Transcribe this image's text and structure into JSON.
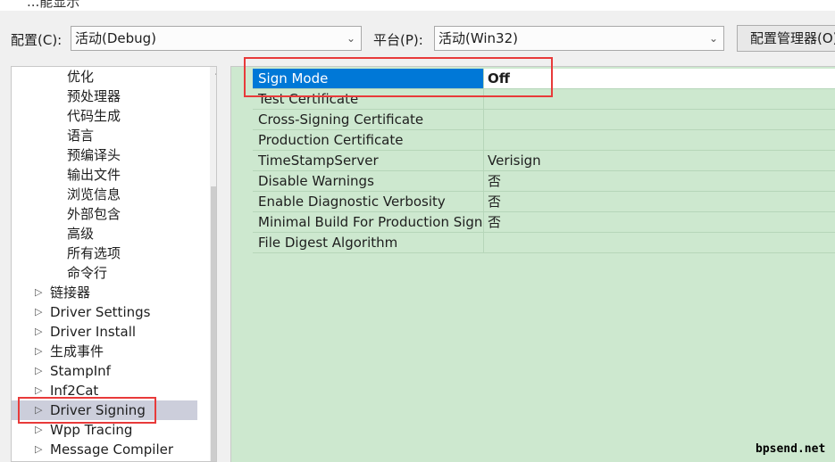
{
  "window": {
    "title_fragment": "...能显示"
  },
  "toolbar": {
    "config_label": "配置(C):",
    "config_value": "活动(Debug)",
    "platform_label": "平台(P):",
    "platform_value": "活动(Win32)",
    "config_manager_button": "配置管理器(O)"
  },
  "tree": {
    "items": [
      {
        "label": "优化",
        "level": 2,
        "expander": ""
      },
      {
        "label": "预处理器",
        "level": 2,
        "expander": ""
      },
      {
        "label": "代码生成",
        "level": 2,
        "expander": ""
      },
      {
        "label": "语言",
        "level": 2,
        "expander": ""
      },
      {
        "label": "预编译头",
        "level": 2,
        "expander": ""
      },
      {
        "label": "输出文件",
        "level": 2,
        "expander": ""
      },
      {
        "label": "浏览信息",
        "level": 2,
        "expander": ""
      },
      {
        "label": "外部包含",
        "level": 2,
        "expander": ""
      },
      {
        "label": "高级",
        "level": 2,
        "expander": ""
      },
      {
        "label": "所有选项",
        "level": 2,
        "expander": ""
      },
      {
        "label": "命令行",
        "level": 2,
        "expander": ""
      },
      {
        "label": "链接器",
        "level": 1,
        "expander": "▷"
      },
      {
        "label": "Driver Settings",
        "level": 1,
        "expander": "▷"
      },
      {
        "label": "Driver Install",
        "level": 1,
        "expander": "▷"
      },
      {
        "label": "生成事件",
        "level": 1,
        "expander": "▷"
      },
      {
        "label": "StampInf",
        "level": 1,
        "expander": "▷"
      },
      {
        "label": "Inf2Cat",
        "level": 1,
        "expander": "▷"
      },
      {
        "label": "Driver Signing",
        "level": 1,
        "expander": "▷",
        "selected": true
      },
      {
        "label": "Wpp Tracing",
        "level": 1,
        "expander": "▷"
      },
      {
        "label": "Message Compiler",
        "level": 1,
        "expander": "▷"
      }
    ]
  },
  "properties": [
    {
      "name": "Sign Mode",
      "value": "Off",
      "selected": true
    },
    {
      "name": "Test Certificate",
      "value": ""
    },
    {
      "name": "Cross-Signing Certificate",
      "value": ""
    },
    {
      "name": "Production Certificate",
      "value": ""
    },
    {
      "name": "TimeStampServer",
      "value": "Verisign"
    },
    {
      "name": "Disable Warnings",
      "value": "否"
    },
    {
      "name": "Enable Diagnostic Verbosity",
      "value": "否"
    },
    {
      "name": "Minimal Build For Production Signing",
      "value": "否"
    },
    {
      "name": "File Digest Algorithm",
      "value": ""
    }
  ],
  "icons": {
    "combo_chevron": "chevron-down-icon",
    "tree_expander": "triangle-right-icon",
    "scroll_up": "chevron-up-icon"
  },
  "colors": {
    "grid_background": "#cde8cf",
    "selection_blue": "#0078d7",
    "tree_selection": "#cccedb",
    "highlight_box": "#e83a3a"
  },
  "watermark": "bpsend.net"
}
